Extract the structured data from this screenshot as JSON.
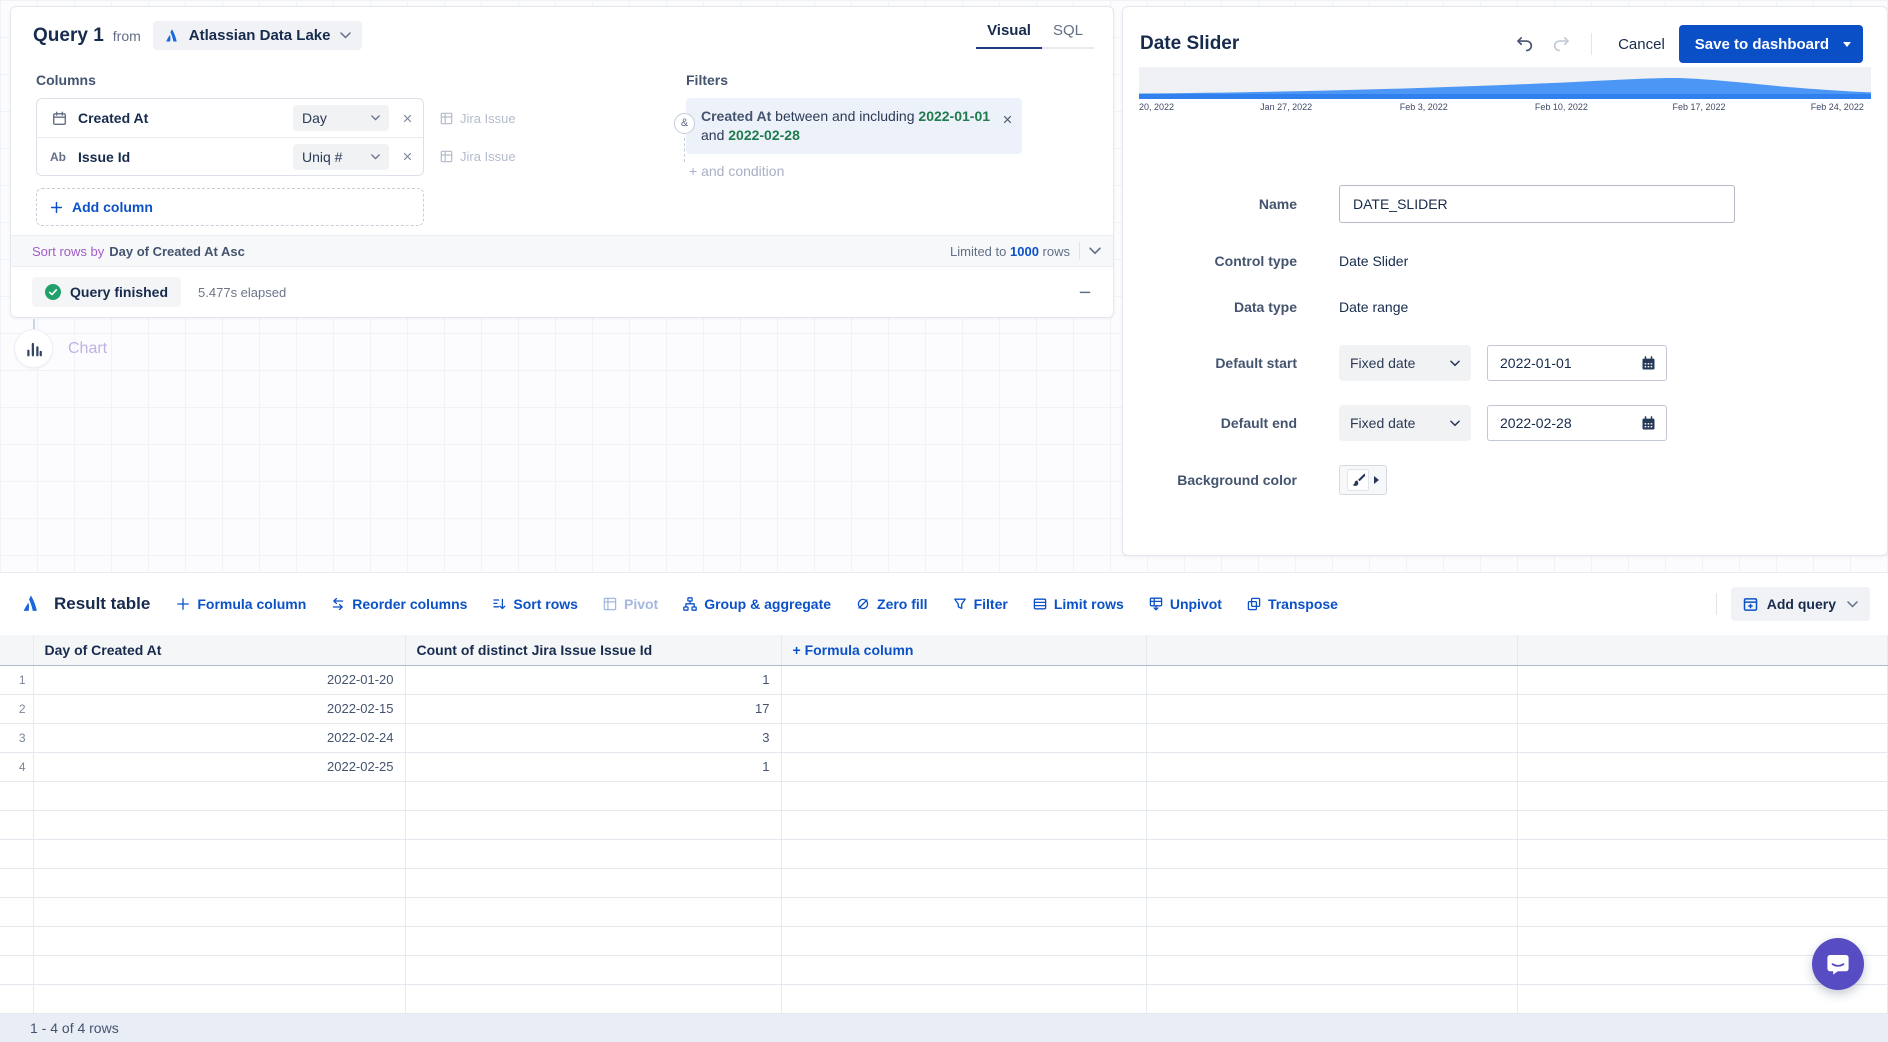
{
  "query_panel": {
    "title": "Query 1",
    "from_label": "from",
    "datasource": "Atlassian Data Lake",
    "tabs": {
      "visual": "Visual",
      "sql": "SQL"
    },
    "columns": {
      "label": "Columns",
      "rows": [
        {
          "name": "Created At",
          "modifier": "Day",
          "source": "Jira Issue",
          "icon": "calendar-icon"
        },
        {
          "name": "Issue Id",
          "modifier": "Uniq #",
          "source": "Jira Issue",
          "icon": "text-icon"
        }
      ],
      "add_label": "Add column"
    },
    "filters": {
      "label": "Filters",
      "operator": "&",
      "field": "Created At",
      "verb": "between and including",
      "start_date": "2022-01-01",
      "conjunction": "and",
      "end_date": "2022-02-28",
      "add_condition": "+ and condition"
    },
    "sort_bar": {
      "prefix": "Sort rows by",
      "value": "Day of Created At Asc",
      "limited_prefix": "Limited to",
      "limit": "1000",
      "rows_word": "rows"
    },
    "status": {
      "label": "Query finished",
      "elapsed": "5.477s elapsed"
    }
  },
  "chart_node": {
    "label": "Chart"
  },
  "control_editor": {
    "title": "Date Slider",
    "cancel": "Cancel",
    "save": "Save to dashboard",
    "slider_ticks": [
      {
        "label": "20, 2022",
        "pos": 0.0
      },
      {
        "label": "Jan 27, 2022",
        "pos": 0.201
      },
      {
        "label": "Feb 3, 2022",
        "pos": 0.389
      },
      {
        "label": "Feb 10, 2022",
        "pos": 0.577
      },
      {
        "label": "Feb 17, 2022",
        "pos": 0.765
      },
      {
        "label": "Feb 24, 2022",
        "pos": 0.954
      }
    ],
    "fields": {
      "name": {
        "label": "Name",
        "value": "DATE_SLIDER"
      },
      "control_type": {
        "label": "Control type",
        "value": "Date Slider"
      },
      "data_type": {
        "label": "Data type",
        "value": "Date range"
      },
      "default_start": {
        "label": "Default start",
        "mode": "Fixed date",
        "value": "2022-01-01"
      },
      "default_end": {
        "label": "Default end",
        "mode": "Fixed date",
        "value": "2022-02-28"
      },
      "background_color": {
        "label": "Background color"
      }
    }
  },
  "result_section": {
    "title": "Result table",
    "actions": [
      {
        "id": "formula-column",
        "label": "Formula column"
      },
      {
        "id": "reorder-columns",
        "label": "Reorder columns"
      },
      {
        "id": "sort-rows",
        "label": "Sort rows"
      },
      {
        "id": "pivot",
        "label": "Pivot",
        "disabled": true
      },
      {
        "id": "group-aggregate",
        "label": "Group & aggregate"
      },
      {
        "id": "zero-fill",
        "label": "Zero fill"
      },
      {
        "id": "filter",
        "label": "Filter"
      },
      {
        "id": "limit-rows",
        "label": "Limit rows"
      },
      {
        "id": "unpivot",
        "label": "Unpivot"
      },
      {
        "id": "transpose",
        "label": "Transpose"
      }
    ],
    "add_query": "Add query",
    "table": {
      "headers": [
        "Day of Created At",
        "Count of distinct Jira Issue Issue Id"
      ],
      "formula_column_header": "+ Formula column",
      "rows": [
        {
          "n": "1",
          "day": "2022-01-20",
          "count": "1"
        },
        {
          "n": "2",
          "day": "2022-02-15",
          "count": "17"
        },
        {
          "n": "3",
          "day": "2022-02-24",
          "count": "3"
        },
        {
          "n": "4",
          "day": "2022-02-25",
          "count": "1"
        }
      ],
      "empty_rows": 8
    },
    "footer": "1 - 4 of 4 rows"
  },
  "colors": {
    "accent_blue": "#0B4FC7",
    "link_blue": "#0B52C8",
    "date_green": "#1F7A4D",
    "sort_purple": "#A05CC8",
    "check_green": "#22A06B",
    "slider_blue": "#4C97F5",
    "chat_purple": "#574CC2"
  }
}
